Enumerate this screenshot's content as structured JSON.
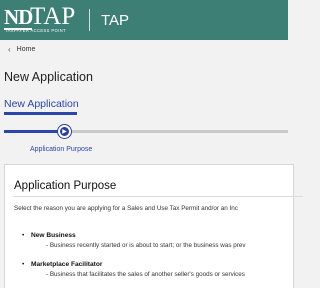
{
  "header": {
    "logo_main": "TAP",
    "logo_prefix": "ND",
    "logo_tagline": "TAXPAYER ACCESS POINT",
    "app_name": "TAP",
    "bg_color": "#3d7e75"
  },
  "breadcrumb": {
    "icon": "chevron-left-icon",
    "label": "Home"
  },
  "page": {
    "title": "New Application",
    "tab_label": "New Application",
    "accent_color": "#2b46a6"
  },
  "stepper": {
    "steps": [
      {
        "label": "Application Purpose",
        "active": true
      }
    ],
    "progress": 0.2
  },
  "card": {
    "title": "Application Purpose",
    "instruction": "Select the reason you are applying for a Sales and Use Tax Permit and/or an Inc",
    "options": [
      {
        "label": "New Business",
        "description": "- Business recently started or is about to start; or the business was prev"
      },
      {
        "label": "Marketplace Facilitator",
        "description": "- Business that facilitates the sales of another seller's goods or services"
      }
    ]
  }
}
